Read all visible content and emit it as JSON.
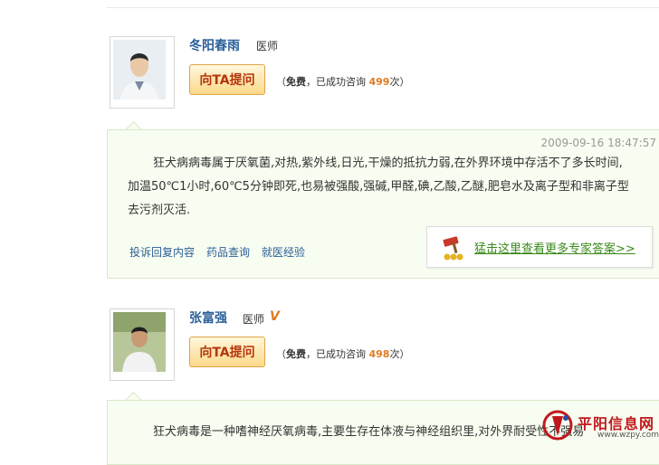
{
  "doctors": [
    {
      "name": "冬阳春雨",
      "role": "医师",
      "verified": false,
      "ask_label": "向TA提问",
      "meta_open": "（",
      "meta_free": "免费",
      "meta_mid": "，已成功咨询 ",
      "meta_count": "499",
      "meta_unit": "次）",
      "answer": {
        "date": "2009-09-16 18:47:57",
        "lines": [
          "狂犬病病毒属于厌氧菌,对热,紫外线,日光,干燥的抵抗力弱,在外界环境中存活不了多长时间,",
          "加温50℃1小时,60℃5分钟即死,也易被强酸,强碱,甲醛,碘,乙酸,乙醚,肥皂水及离子型和非离子型",
          "去污剂灭活."
        ],
        "links": [
          "投诉回复内容",
          "药品查询",
          "就医经验"
        ],
        "more_label": "猛击这里查看更多专家答案>>"
      }
    },
    {
      "name": "张富强",
      "role": "医师",
      "verified": true,
      "badge": "V",
      "ask_label": "向TA提问",
      "meta_open": "（",
      "meta_free": "免费",
      "meta_mid": "，已成功咨询 ",
      "meta_count": "498",
      "meta_unit": "次）",
      "answer": {
        "lines": [
          "狂犬病毒是一种嗜神经厌氧病毒,主要生存在体液与神经组织里,对外界耐受性不强易"
        ]
      }
    }
  ],
  "watermark": {
    "title": "平阳信息网",
    "url": "www.wzpy.com"
  },
  "colors": {
    "name": "#2b5f98",
    "count": "#e07b1f",
    "ask_text": "#b5360b",
    "answer_bg": "#f7fdf0",
    "more_link": "#3a8a1a",
    "watermark": "#c2171d"
  },
  "icons": [
    "doctor-avatar",
    "verified-v-icon",
    "gavel-icon",
    "site-logo-icon"
  ]
}
